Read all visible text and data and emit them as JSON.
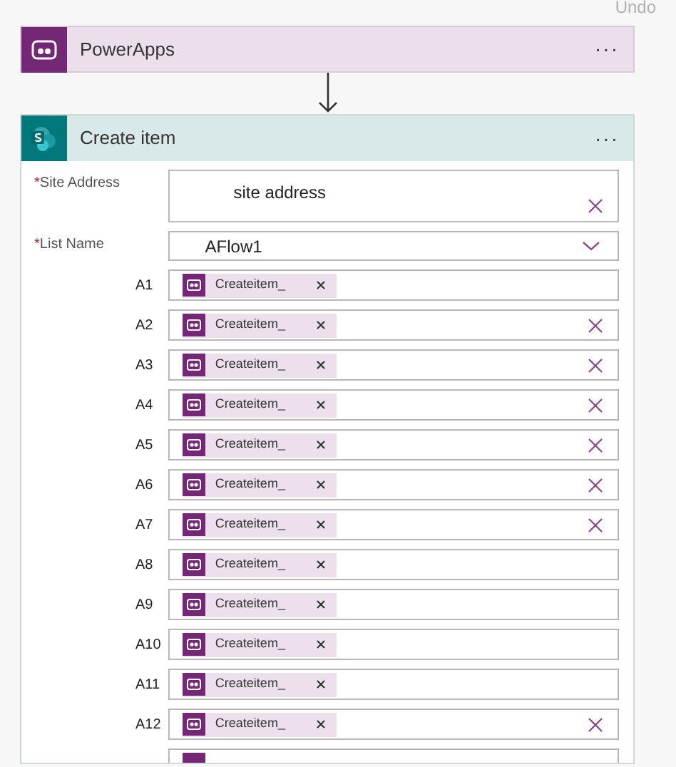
{
  "toolbar": {
    "undo": "Undo"
  },
  "trigger": {
    "title": "PowerApps",
    "menu": "···"
  },
  "action": {
    "title": "Create item",
    "menu": "···",
    "site_address": {
      "required_mark": "*",
      "label": "Site Address",
      "value": "site address"
    },
    "list_name": {
      "required_mark": "*",
      "label": "List Name",
      "value": "AFlow1"
    },
    "rows": [
      {
        "label": "A1",
        "token": "Createitem_",
        "clearable": false
      },
      {
        "label": "A2",
        "token": "Createitem_",
        "clearable": true
      },
      {
        "label": "A3",
        "token": "Createitem_",
        "clearable": true
      },
      {
        "label": "A4",
        "token": "Createitem_",
        "clearable": true
      },
      {
        "label": "A5",
        "token": "Createitem_",
        "clearable": true
      },
      {
        "label": "A6",
        "token": "Createitem_",
        "clearable": true
      },
      {
        "label": "A7",
        "token": "Createitem_",
        "clearable": true
      },
      {
        "label": "A8",
        "token": "Createitem_",
        "clearable": false
      },
      {
        "label": "A9",
        "token": "Createitem_",
        "clearable": false
      },
      {
        "label": "A10",
        "token": "Createitem_",
        "clearable": false
      },
      {
        "label": "A11",
        "token": "Createitem_",
        "clearable": false
      },
      {
        "label": "A12",
        "token": "Createitem_",
        "clearable": true
      }
    ]
  }
}
